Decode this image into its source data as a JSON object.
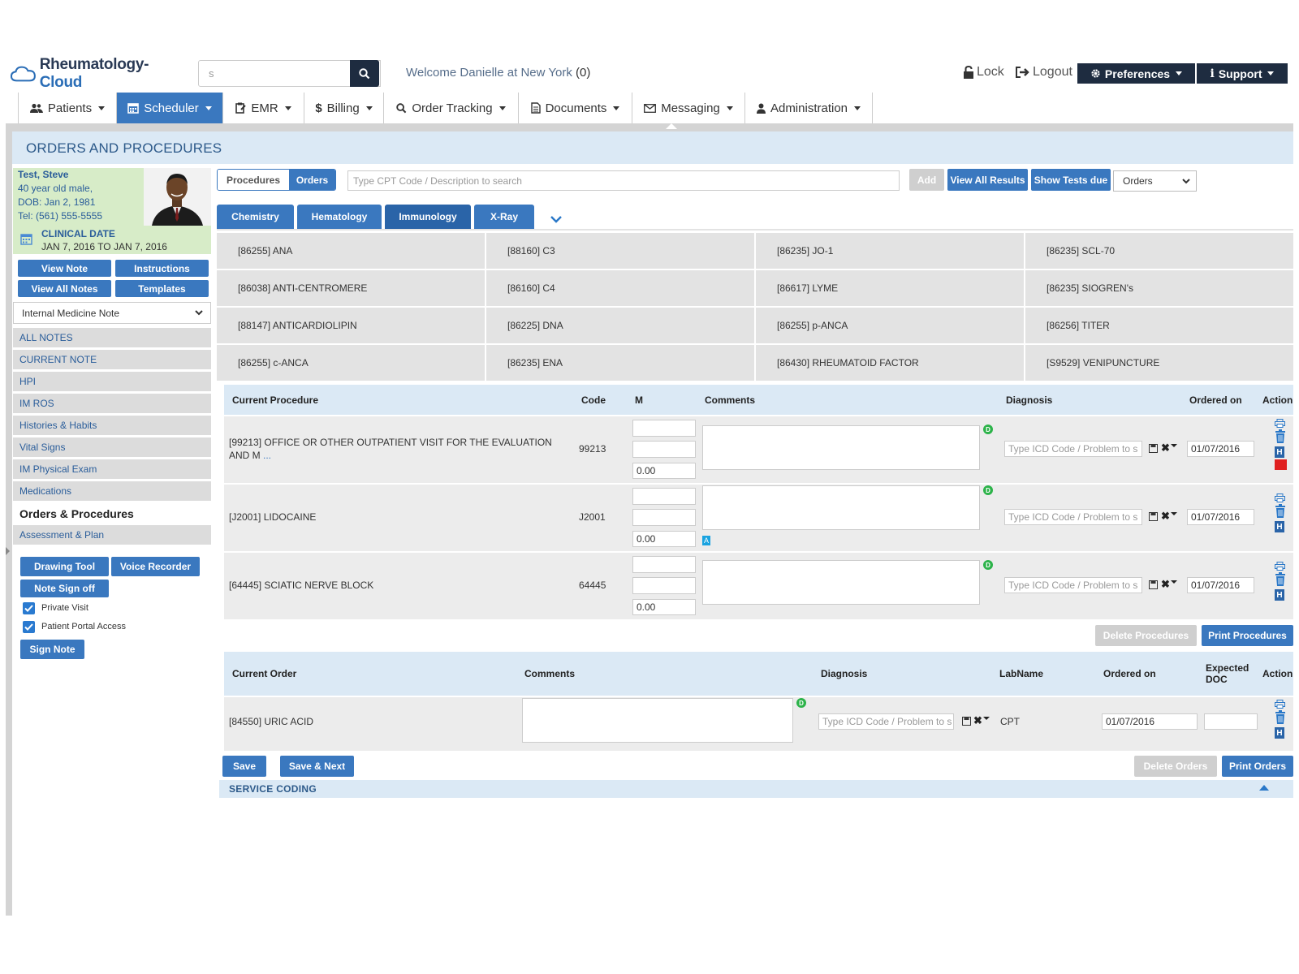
{
  "app": {
    "logo_part1": "Rheumatology-",
    "logo_part2": "Cloud",
    "search_value": "s",
    "welcome_prefix": "Welcome Danielle at New York ",
    "welcome_count": "(0)",
    "lock_label": "Lock",
    "logout_label": "Logout",
    "preferences_label": "Preferences",
    "support_label": "Support",
    "brand_color": "#3a78bf",
    "dark_color": "#1e2c40"
  },
  "nav": [
    {
      "label": "Patients",
      "icon": "users-icon"
    },
    {
      "label": "Scheduler",
      "icon": "calendar-icon"
    },
    {
      "label": "EMR",
      "icon": "clipboard-icon"
    },
    {
      "label": "Billing",
      "icon": "dollar-icon"
    },
    {
      "label": "Order Tracking",
      "icon": "search-icon"
    },
    {
      "label": "Documents",
      "icon": "document-icon"
    },
    {
      "label": "Messaging",
      "icon": "envelope-icon"
    },
    {
      "label": "Administration",
      "icon": "user-icon"
    }
  ],
  "page_title": "ORDERS AND PROCEDURES",
  "patient": {
    "name": "Test, Steve",
    "age_sex": "40 year old male,",
    "dob": "DOB: Jan 2, 1981",
    "tel": "Tel: (561) 555-5555",
    "clinical_label": "CLINICAL DATE",
    "clinical_range": "JAN 7, 2016 TO JAN 7, 2016"
  },
  "sidebar": {
    "view_note": "View Note",
    "instructions": "Instructions",
    "view_all_notes": "View All Notes",
    "templates": "Templates",
    "note_type": "Internal Medicine Note",
    "items": [
      "ALL NOTES",
      "CURRENT NOTE",
      "HPI",
      "IM ROS",
      "Histories & Habits",
      "Vital Signs",
      "IM Physical Exam",
      "Medications",
      "Orders & Procedures",
      "Assessment & Plan"
    ],
    "drawing_tool": "Drawing Tool",
    "voice_recorder": "Voice Recorder",
    "note_sign_off": "Note Sign off",
    "private_visit": "Private Visit",
    "portal_access": "Patient Portal Access",
    "sign_note": "Sign Note"
  },
  "toolbar": {
    "procedures_tab": "Procedures",
    "orders_tab": "Orders",
    "cpt_placeholder": "Type CPT Code / Description to search",
    "add": "Add",
    "view_all_results": "View All Results",
    "show_tests_due": "Show Tests due",
    "filter_value": "Orders"
  },
  "categories": [
    "Chemistry",
    "Hematology",
    "Immunology",
    "X-Ray"
  ],
  "tests": [
    "[86255] ANA",
    "[88160] C3",
    "[86235] JO-1",
    "[86235] SCL-70",
    "[86038] ANTI-CENTROMERE",
    "[86160] C4",
    "[86617] LYME",
    "[86235] SIOGREN's",
    "[88147] ANTICARDIOLIPIN",
    "[86225] DNA",
    "[86255] p-ANCA",
    "[86256] TITER",
    "[86255] c-ANCA",
    "[86235] ENA",
    "[86430] RHEUMATOID FACTOR",
    "[S9529] VENIPUNCTURE"
  ],
  "procedures": {
    "headers": {
      "procedure": "Current Procedure",
      "code": "Code",
      "m": "M",
      "comments": "Comments",
      "diagnosis": "Diagnosis",
      "ordered_on": "Ordered on",
      "action": "Action"
    },
    "rows": [
      {
        "name": "[99213] OFFICE OR OTHER OUTPATIENT VISIT FOR THE EVALUATION AND M",
        "more": "...",
        "code": "99213",
        "units": "0.00",
        "icd_placeholder": "Type ICD Code / Problem to s",
        "date": "01/07/2016"
      },
      {
        "name": "[J2001] LIDOCAINE",
        "more": "",
        "code": "J2001",
        "units": "0.00",
        "icd_placeholder": "Type ICD Code / Problem to s",
        "date": "01/07/2016"
      },
      {
        "name": "[64445] SCIATIC NERVE BLOCK",
        "more": "",
        "code": "64445",
        "units": "0.00",
        "icd_placeholder": "Type ICD Code / Problem to s",
        "date": "01/07/2016"
      }
    ],
    "delete_label": "Delete Procedures",
    "print_label": "Print Procedures",
    "dot_letter": "D",
    "h_letter": "H",
    "a_letter": "A"
  },
  "orders": {
    "headers": {
      "order": "Current Order",
      "comments": "Comments",
      "diagnosis": "Diagnosis",
      "labname": "LabName",
      "ordered_on": "Ordered on",
      "expected_1": "Expected",
      "expected_2": "DOC",
      "action": "Action"
    },
    "rows": [
      {
        "name": "[84550] URIC ACID",
        "icd_placeholder": "Type ICD Code / Problem to s",
        "lab": "CPT",
        "date": "01/07/2016",
        "expected": ""
      }
    ],
    "save": "Save",
    "save_next": "Save & Next",
    "delete_label": "Delete Orders",
    "print_label": "Print Orders"
  },
  "service_coding": "SERVICE CODING"
}
